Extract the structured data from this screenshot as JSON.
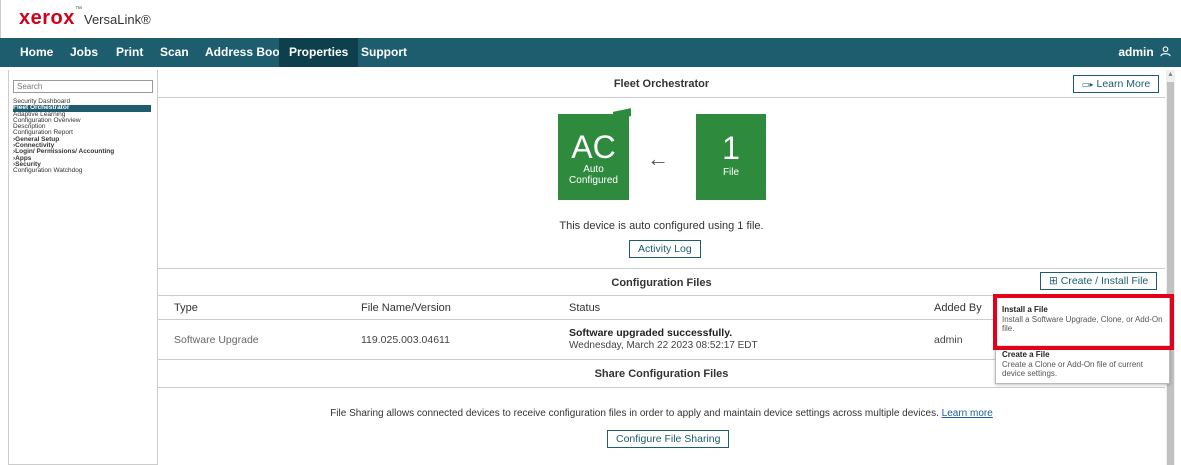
{
  "brand": {
    "logo": "xerox",
    "logo_tm": "™",
    "product": "VersaLink®"
  },
  "nav": {
    "items": [
      "Home",
      "Jobs",
      "Print",
      "Scan",
      "Address Book",
      "Properties",
      "Support"
    ],
    "active": "Properties",
    "user": "admin"
  },
  "sidebar": {
    "search_placeholder": "Search",
    "items": [
      "Security Dashboard",
      "Fleet Orchestrator",
      "Adaptive Learning",
      "Configuration Overview",
      "Description",
      "Configuration Report",
      "General Setup",
      "Connectivity",
      "Login/ Permissions/ Accounting",
      "Apps",
      "Security",
      "Configuration Watchdog"
    ],
    "active": "Fleet Orchestrator"
  },
  "fleet": {
    "title": "Fleet Orchestrator",
    "learn_more": "Learn More",
    "tile_ac": {
      "big": "AC",
      "line1": "Auto",
      "line2": "Configured"
    },
    "tile_file": {
      "big": "1",
      "label": "File"
    },
    "message": "This device is auto configured using 1 file.",
    "activity_log": "Activity Log"
  },
  "config_files": {
    "title": "Configuration Files",
    "create_button": "Create / Install File",
    "columns": [
      "Type",
      "File Name/Version",
      "Status",
      "Added By"
    ],
    "rows": [
      {
        "type": "Software Upgrade",
        "file": "119.025.003.04611",
        "status": "Software upgraded successfully.",
        "status_date": "Wednesday, March 22 2023 08:52:17 EDT",
        "added_by": "admin"
      }
    ]
  },
  "share": {
    "title": "Share Configuration Files",
    "description": "File Sharing allows connected devices to receive configuration files in order to apply and maintain device settings across multiple devices.",
    "learn_more": "Learn more",
    "configure_button": "Configure File Sharing"
  },
  "dropdown": {
    "install": {
      "title": "Install a File",
      "desc": "Install a Software Upgrade, Clone, or Add-On file."
    },
    "create": {
      "title": "Create a File",
      "desc": "Create a Clone or Add-On file of current device settings."
    }
  },
  "colors": {
    "brand_red": "#d0021b",
    "nav": "#1d5d6e",
    "nav_active": "#0d3f4d",
    "tile": "#2e8b3e",
    "highlight": "#e3001b"
  }
}
